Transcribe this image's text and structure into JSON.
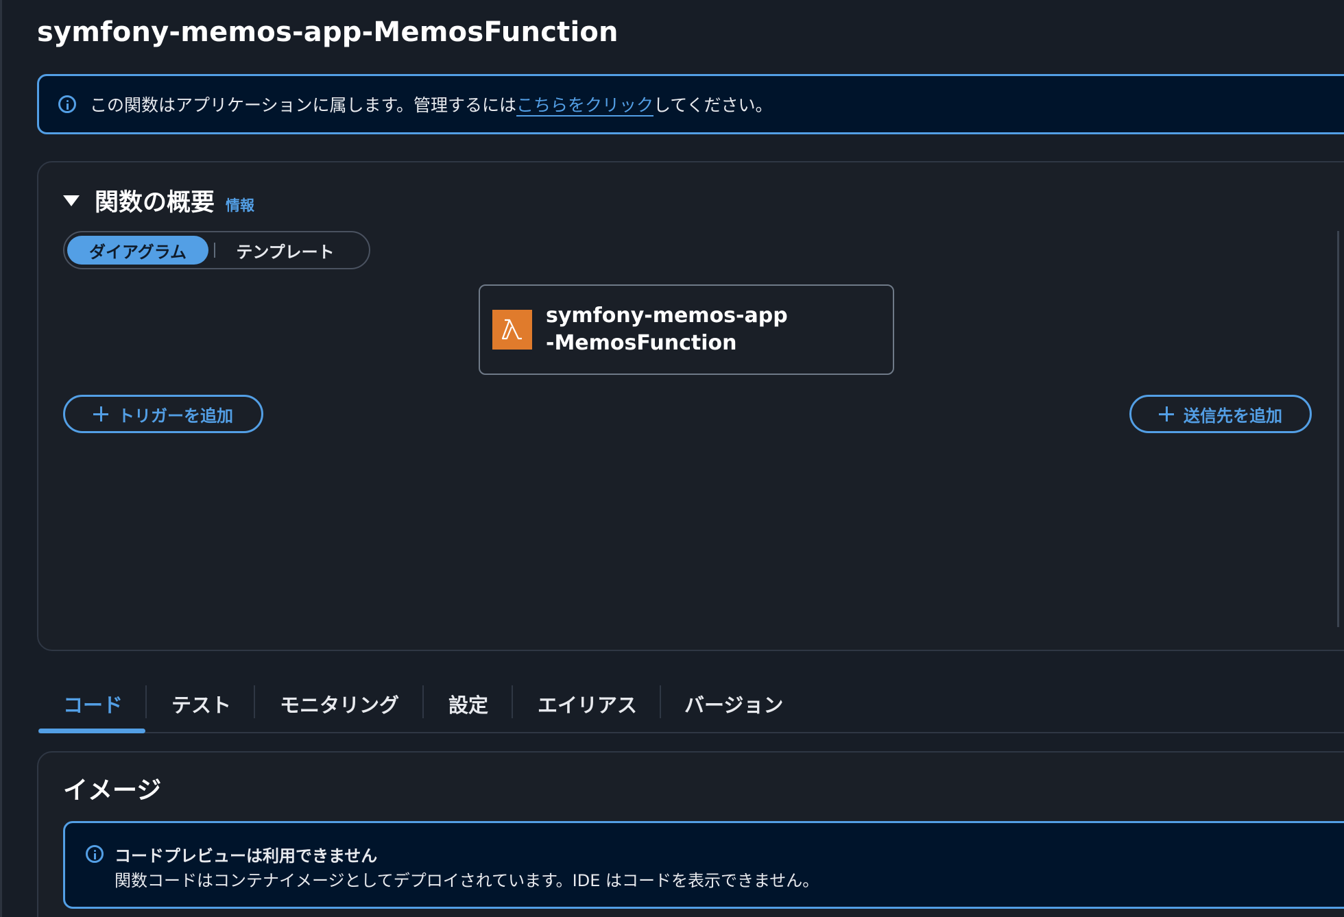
{
  "page": {
    "title": "symfony-memos-app-MemosFunction"
  },
  "app_banner": {
    "icon": "info-icon",
    "text_before": "この関数はアプリケーションに属します。管理するには",
    "link_text": "こちらをクリック",
    "text_after": "してください。"
  },
  "overview": {
    "title": "関数の概要",
    "info_link": "情報",
    "view_toggle": {
      "options": [
        "ダイアグラム",
        "テンプレート"
      ],
      "selected": "ダイアグラム"
    },
    "function_node": {
      "icon": "lambda-icon",
      "name": "symfony-memos-app-MemosFunction"
    },
    "add_trigger_label": "トリガーを追加",
    "add_destination_label": "送信先を追加"
  },
  "tabs": {
    "items": [
      "コード",
      "テスト",
      "モニタリング",
      "設定",
      "エイリアス",
      "バージョン"
    ],
    "active": "コード"
  },
  "image_section": {
    "title": "イメージ",
    "preview_notice": {
      "icon": "info-icon",
      "title": "コードプレビューは利用できません",
      "body": "関数コードはコンテナイメージとしてデプロイされています。IDE はコードを表示できません。"
    }
  },
  "colors": {
    "accent": "#539fe5",
    "background": "#171d26",
    "banner_background": "#00142b",
    "lambda_orange": "#e07b2c"
  }
}
